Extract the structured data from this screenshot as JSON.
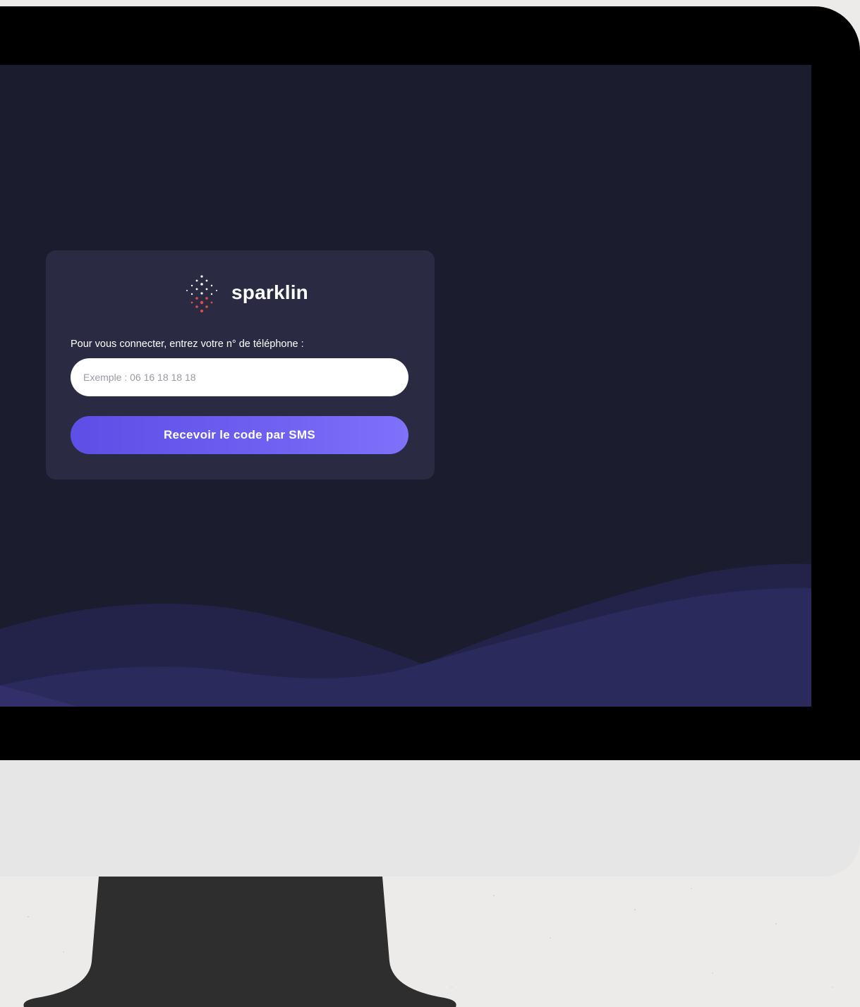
{
  "login": {
    "brand_name": "sparklin",
    "prompt": "Pour vous connecter, entrez votre n° de téléphone :",
    "phone_placeholder": "Exemple : 06 16 18 18 18",
    "submit_label": "Recevoir le code par SMS"
  },
  "colors": {
    "screen_background": "#1b1c2e",
    "card_background": "#2a2a43",
    "button_accent": "#6d5ff0",
    "wave": "#2b2a5c"
  },
  "icons": {
    "brand_logo": "sparklin-dots-logo"
  }
}
